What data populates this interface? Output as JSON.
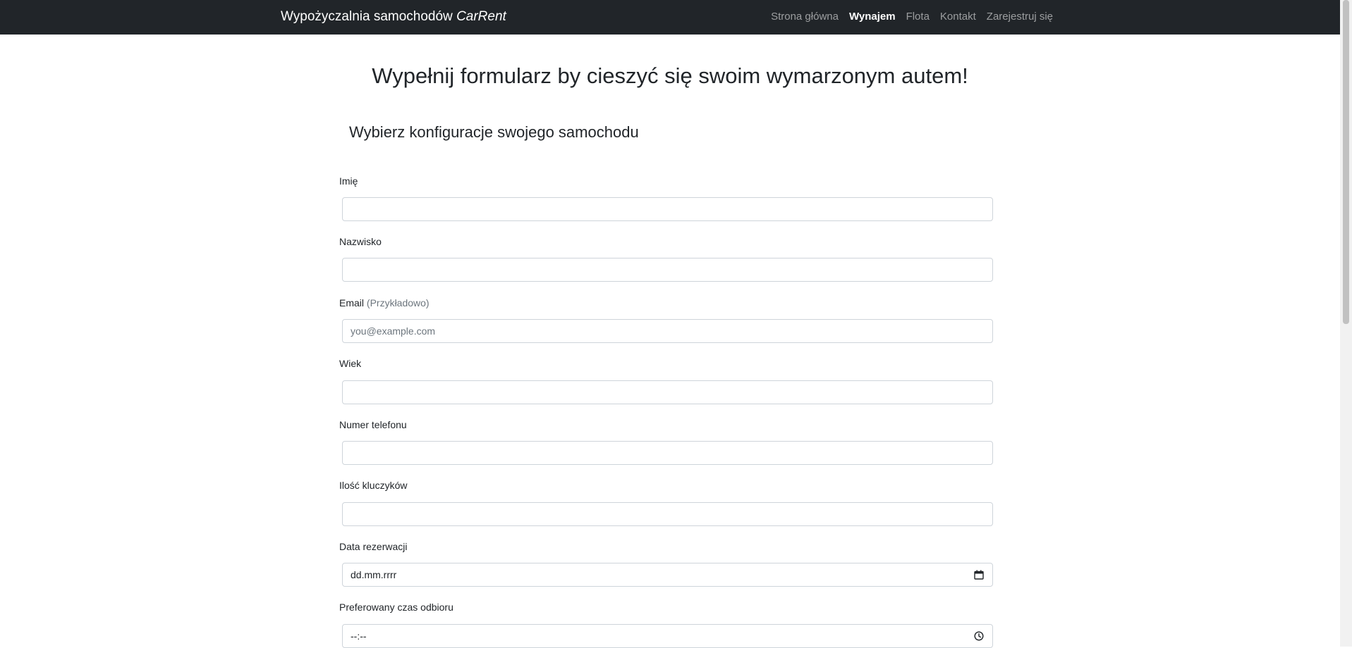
{
  "navbar": {
    "brand_text": "Wypożyczalnia samochodów ",
    "brand_italic": "CarRent",
    "links": [
      {
        "label": "Strona główna",
        "active": false
      },
      {
        "label": "Wynajem",
        "active": true
      },
      {
        "label": "Flota",
        "active": false
      },
      {
        "label": "Kontakt",
        "active": false
      },
      {
        "label": "Zarejestruj się",
        "active": false
      }
    ]
  },
  "main": {
    "title": "Wypełnij formularz by cieszyć się swoim wymarzonym autem!",
    "section_title": "Wybierz konfiguracje swojego samochodu"
  },
  "form": {
    "first_name": {
      "label": "Imię",
      "value": ""
    },
    "last_name": {
      "label": "Nazwisko",
      "value": ""
    },
    "email": {
      "label": "Email",
      "label_hint": "(Przykładowo)",
      "placeholder": "you@example.com",
      "value": ""
    },
    "age": {
      "label": "Wiek",
      "value": ""
    },
    "phone": {
      "label": "Numer telefonu",
      "value": ""
    },
    "keys": {
      "label": "Ilość kluczyków",
      "value": ""
    },
    "reservation_date": {
      "label": "Data rezerwacji",
      "value": "dd.mm.rrrr"
    },
    "pickup_time": {
      "label": "Preferowany czas odbioru",
      "value": "--:--"
    }
  },
  "colors": {
    "navbar_bg": "#212529",
    "nav_link": "#9a9da0",
    "nav_link_active": "#ffffff",
    "input_border": "#ced4da",
    "muted_text": "#6c757d"
  },
  "icons": {
    "date_picker": "calendar-icon",
    "time_picker": "clock-icon"
  }
}
